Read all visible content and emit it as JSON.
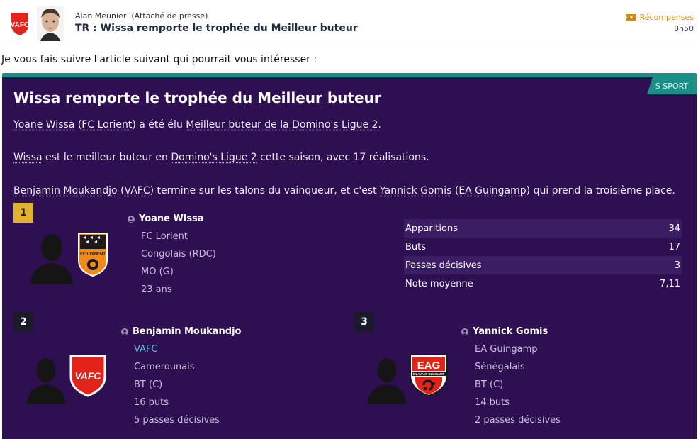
{
  "header": {
    "sender": "Alan Meunier",
    "sender_role": "(Attaché de presse)",
    "subject": "TR : Wissa remporte le trophée du Meilleur buteur",
    "reward_label": "Récompenses",
    "time": "8h50",
    "club_abbr": "VAFC"
  },
  "intro": "Je vous fais suivre l'article suivant qui pourrait vous intéresser :",
  "article": {
    "source": "S SPORT",
    "title": "Wissa remporte le trophée du Meilleur buteur",
    "p1": [
      "Yoane Wissa",
      " (",
      "FC Lorient",
      ") a été élu ",
      "Meilleur buteur de la Domino's Ligue 2",
      "."
    ],
    "p2": [
      "Wissa",
      " est le meilleur buteur en ",
      "Domino's Ligue 2",
      " cette saison, avec 17 réalisations."
    ],
    "p3": [
      "Benjamin Moukandjo",
      " (",
      "VAFC",
      ") termine sur les talons du vainqueur, et c'est ",
      "Yannick Gomis",
      " (",
      "EA Guingamp",
      ") qui prend la troisième place."
    ]
  },
  "winners": [
    {
      "rank": "1",
      "name": "Yoane Wissa",
      "club": "FC Lorient",
      "nationality": "Congolais (RDC)",
      "position": "MO (G)",
      "extra": "23 ans",
      "crest_text": "FC LORIENT"
    },
    {
      "rank": "2",
      "name": "Benjamin Moukandjo",
      "club": "VAFC",
      "nationality": "Camerounais",
      "position": "BT (C)",
      "goals": "16 buts",
      "assists": "5 passes décisives",
      "crest_text": "VAFC"
    },
    {
      "rank": "3",
      "name": "Yannick Gomis",
      "club": "EA Guingamp",
      "nationality": "Sénégalais",
      "position": "BT (C)",
      "goals": "14 buts",
      "assists": "2 passes décisives",
      "crest_text": "EAG",
      "crest_subtext": "EN AVANT GUINGAMP"
    }
  ],
  "stats": [
    {
      "label": "Apparitions",
      "value": "34"
    },
    {
      "label": "Buts",
      "value": "17"
    },
    {
      "label": "Passes décisives",
      "value": "3"
    },
    {
      "label": "Note moyenne",
      "value": "7,11"
    }
  ],
  "colors": {
    "card_bg": "#2e0f52",
    "accent_teal": "#1b8f86",
    "gold": "#e0b22f",
    "reward_orange": "#d08a1a",
    "vafc_red": "#e2231a"
  },
  "icons": {
    "reward": "ticket-icon",
    "person": "person-icon"
  }
}
